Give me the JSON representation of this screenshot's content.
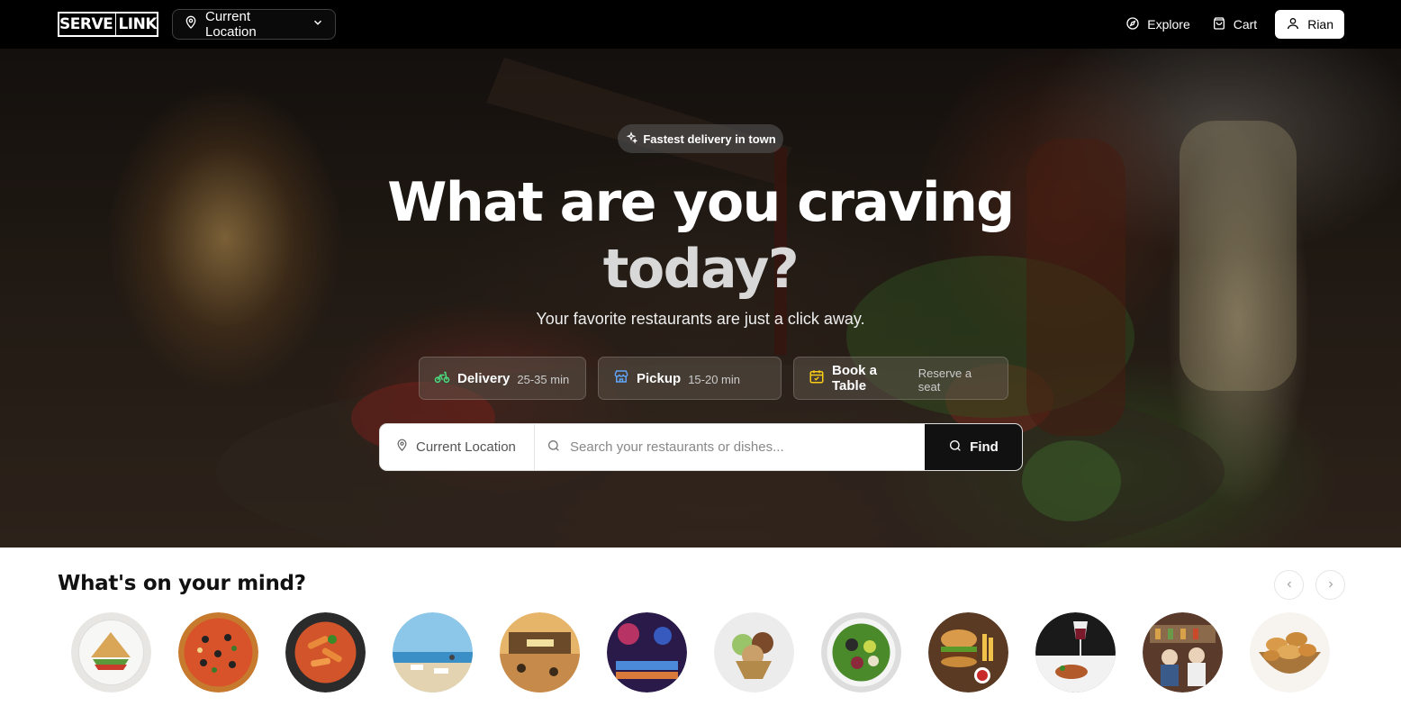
{
  "nav": {
    "logo": {
      "left": "SERVE",
      "right": "LINK"
    },
    "location_label": "Current Location",
    "links": {
      "explore": "Explore",
      "cart": "Cart",
      "user": "Rian"
    }
  },
  "hero": {
    "badge": "Fastest delivery in town",
    "title_line1": "What are you craving",
    "title_line2": "today?",
    "subtitle": "Your favorite restaurants are just a click away.",
    "modes": {
      "delivery": {
        "label": "Delivery",
        "sub": "25-35 min",
        "icon": "bike-icon",
        "color": "#4ade80"
      },
      "pickup": {
        "label": "Pickup",
        "sub": "15-20 min",
        "icon": "store-icon",
        "color": "#60a5fa"
      },
      "table": {
        "label": "Book a Table",
        "sub": "Reserve a seat",
        "icon": "calendar-icon",
        "color": "#facc15"
      }
    },
    "search": {
      "location": "Current Location",
      "placeholder": "Search your restaurants or dishes...",
      "find_label": "Find"
    }
  },
  "mind": {
    "title": "What's on your mind?",
    "categories": [
      {
        "name": "sandwich"
      },
      {
        "name": "pizza"
      },
      {
        "name": "pasta"
      },
      {
        "name": "beach-cafe"
      },
      {
        "name": "beach-bar"
      },
      {
        "name": "nightlife"
      },
      {
        "name": "ice-cream"
      },
      {
        "name": "salad-bowl"
      },
      {
        "name": "burger-fries"
      },
      {
        "name": "fine-dining"
      },
      {
        "name": "pub"
      },
      {
        "name": "bakery"
      }
    ]
  }
}
